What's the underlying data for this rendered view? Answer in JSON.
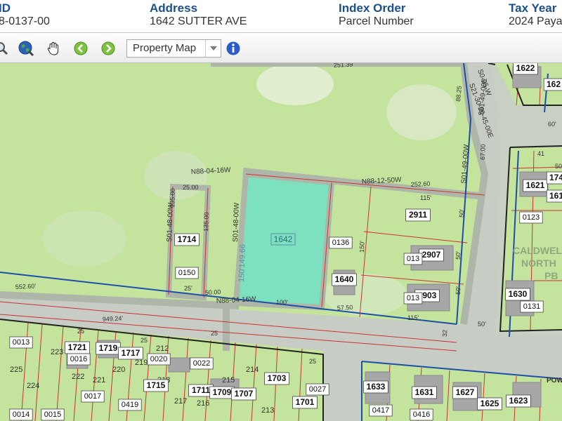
{
  "header": {
    "columns": [
      {
        "label": "ID",
        "value": "8-0137-00"
      },
      {
        "label": "Address",
        "value": "1642 SUTTER AVE"
      },
      {
        "label": "Index Order",
        "value": "Parcel Number"
      },
      {
        "label": "Tax Year",
        "value": "2024 Paya"
      }
    ]
  },
  "toolbar": {
    "tools": [
      "zoom-icon",
      "globe-icon",
      "pan-hand-icon",
      "back-arrow-icon",
      "forward-arrow-icon",
      "info-icon"
    ],
    "layer_select": {
      "selected": "Property Map"
    }
  },
  "map": {
    "colors": {
      "lot_fill": "#c4e39c",
      "road": "#c7ccc4",
      "selected_parcel": "#7de0bf",
      "parcel_line": "#cc3333",
      "district_line": "#1d4fa8",
      "block_line": "#222222",
      "building": "#a7a7a7",
      "highlight": "#adb6a8"
    },
    "selected_parcel": {
      "number": "1642",
      "depth": "150'149.66"
    },
    "bearings": [
      "N88-04-16W",
      "N88-12-50W",
      "S01-48-00W",
      "S01-48-00W",
      "S01-49-00W",
      "S01-49-00E",
      "N88-04-16W",
      "S21-30-30-45-00E",
      "S0-05-W"
    ],
    "dimensions": [
      "252.60",
      "25.00",
      "135.00",
      "135.00",
      "50.00",
      "25'",
      "552.60'",
      "949.24'",
      "115'",
      "115'",
      "150'",
      "100'",
      "57.50",
      "50'",
      "50'",
      "60'",
      "50'",
      "50'",
      "50'",
      "25",
      "25",
      "25",
      "25",
      "88.25",
      "67.00",
      "251.39",
      "32",
      "41"
    ],
    "address_labels": [
      "1714",
      "1640",
      "2911",
      "2907",
      "2903",
      "1622",
      "162",
      "1621",
      "1630",
      "1721",
      "1719",
      "1717",
      "1715",
      "1711",
      "1709",
      "1707",
      "1703",
      "1701",
      "1633",
      "1631",
      "1627",
      "1625",
      "1623",
      "174",
      "161"
    ],
    "parcel_labels": [
      "0150",
      "0136",
      "013",
      "013",
      "0123",
      "0131",
      "0013",
      "0016",
      "0020",
      "0022",
      "0017",
      "0419",
      "0027",
      "0417",
      "0416",
      "0014",
      "0015"
    ],
    "lot_numbers": [
      "225",
      "224",
      "223",
      "222",
      "221",
      "220",
      "219",
      "218",
      "217",
      "216",
      "215",
      "214",
      "213",
      "212"
    ],
    "district_labels": [
      "CALDWEL",
      "NORTH",
      "PB"
    ],
    "street_fragment": "POW"
  }
}
